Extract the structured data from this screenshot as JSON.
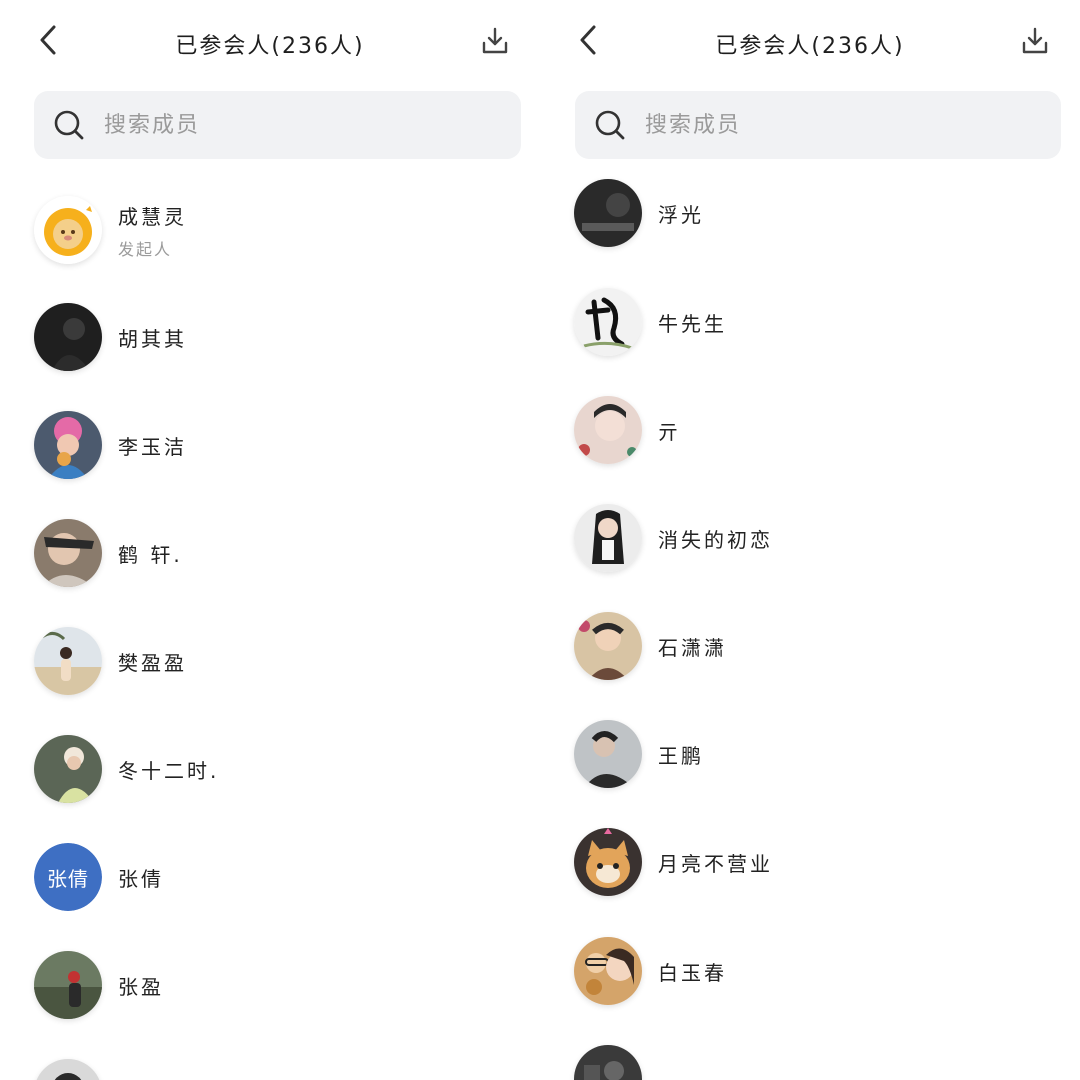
{
  "left": {
    "title": "已参会人(236人)",
    "search_placeholder": "搜索成员",
    "members": [
      {
        "name": "成慧灵",
        "role": "发起人",
        "avatar": "cartoon-lion"
      },
      {
        "name": "胡其其",
        "avatar": "photo"
      },
      {
        "name": "李玉洁",
        "avatar": "photo"
      },
      {
        "name": "鹤   轩.",
        "avatar": "photo"
      },
      {
        "name": "樊盈盈",
        "avatar": "photo"
      },
      {
        "name": "冬十二时.",
        "avatar": "photo"
      },
      {
        "name": "张倩",
        "avatar": "text",
        "avatar_text": "张倩",
        "avatar_color": "#3e6fc3"
      },
      {
        "name": "张盈",
        "avatar": "photo"
      },
      {
        "name": "",
        "avatar": "photo"
      }
    ]
  },
  "right": {
    "title": "已参会人(236人)",
    "search_placeholder": "搜索成员",
    "members": [
      {
        "name": "浮光",
        "avatar": "photo"
      },
      {
        "name": "牛先生",
        "avatar": "calligraphy"
      },
      {
        "name": "亓",
        "avatar": "photo"
      },
      {
        "name": "消失的初恋",
        "avatar": "photo"
      },
      {
        "name": "石潇潇",
        "avatar": "photo"
      },
      {
        "name": "王鹏",
        "avatar": "photo"
      },
      {
        "name": "月亮不营业",
        "avatar": "cat"
      },
      {
        "name": "白玉春",
        "avatar": "photo"
      },
      {
        "name": "",
        "avatar": "photo"
      }
    ]
  },
  "icons": {
    "back": "chevron-left-icon",
    "download": "download-icon",
    "search": "search-icon"
  },
  "colors": {
    "search_bg": "#f1f2f4",
    "text_primary": "#222222",
    "text_secondary": "#9b9b9b",
    "text_avatar_bg": "#3e6fc3"
  }
}
